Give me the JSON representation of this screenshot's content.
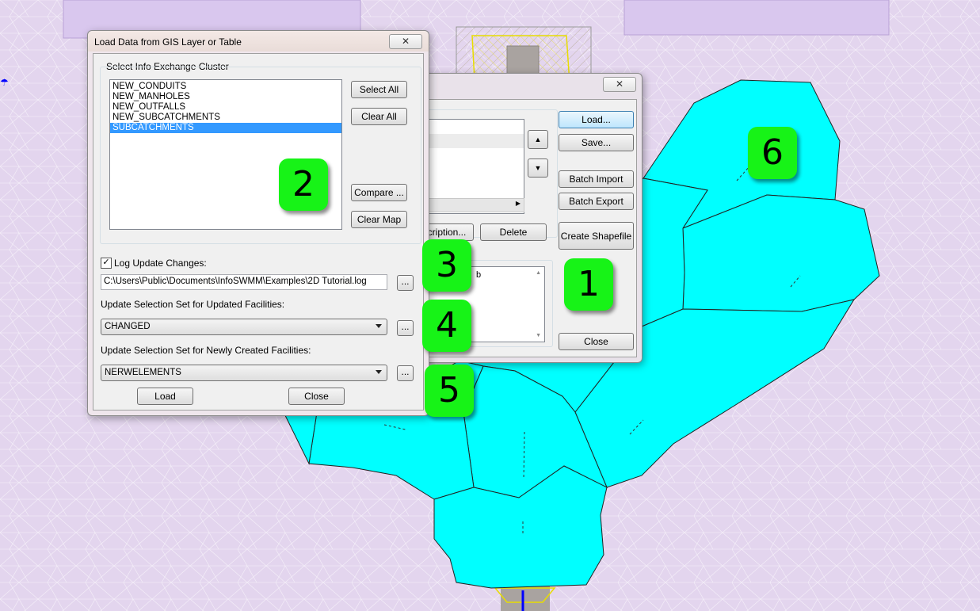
{
  "colors": {
    "mesh_background": "#e3d5ee",
    "subcatchment_fill": "#00ffff",
    "badge_fill": "#17f317",
    "selection": "#3399ff"
  },
  "back_dialog": {
    "close_glyph": "✕",
    "buttons": {
      "load": "Load...",
      "save": "Save...",
      "batch_import": "Batch Import",
      "batch_export": "Batch Export",
      "create_shapefile": "Create Shapefile",
      "description": "cription...",
      "delete": "Delete",
      "close": "Close"
    },
    "list_fragment": "b",
    "up_arrow": "▲",
    "down_arrow": "▼"
  },
  "front_dialog": {
    "title": "Load Data from GIS Layer or Table",
    "close_glyph": "✕",
    "cluster_group_label": "Select Info Exchange Cluster",
    "cluster_items": [
      "NEW_CONDUITS",
      "NEW_MANHOLES",
      "NEW_OUTFALLS",
      "NEW_SUBCATCHMENTS",
      "SUBCATCHMENTS"
    ],
    "selected_item": "SUBCATCHMENTS",
    "select_all": "Select All",
    "clear_all": "Clear All",
    "compare": "Compare ...",
    "clear_map": "Clear Map",
    "log_checked": true,
    "log_label": "Log Update Changes:",
    "log_path": "C:\\Users\\Public\\Documents\\InfoSWMM\\Examples\\2D Tutorial.log",
    "browse": "...",
    "updated_label": "Update Selection Set for Updated Facilities:",
    "updated_value": "CHANGED",
    "new_label": "Update Selection Set for Newly Created Facilities:",
    "new_value": "NERWELEMENTS",
    "load": "Load",
    "close": "Close"
  },
  "badges": [
    "1",
    "2",
    "3",
    "4",
    "5",
    "6"
  ]
}
